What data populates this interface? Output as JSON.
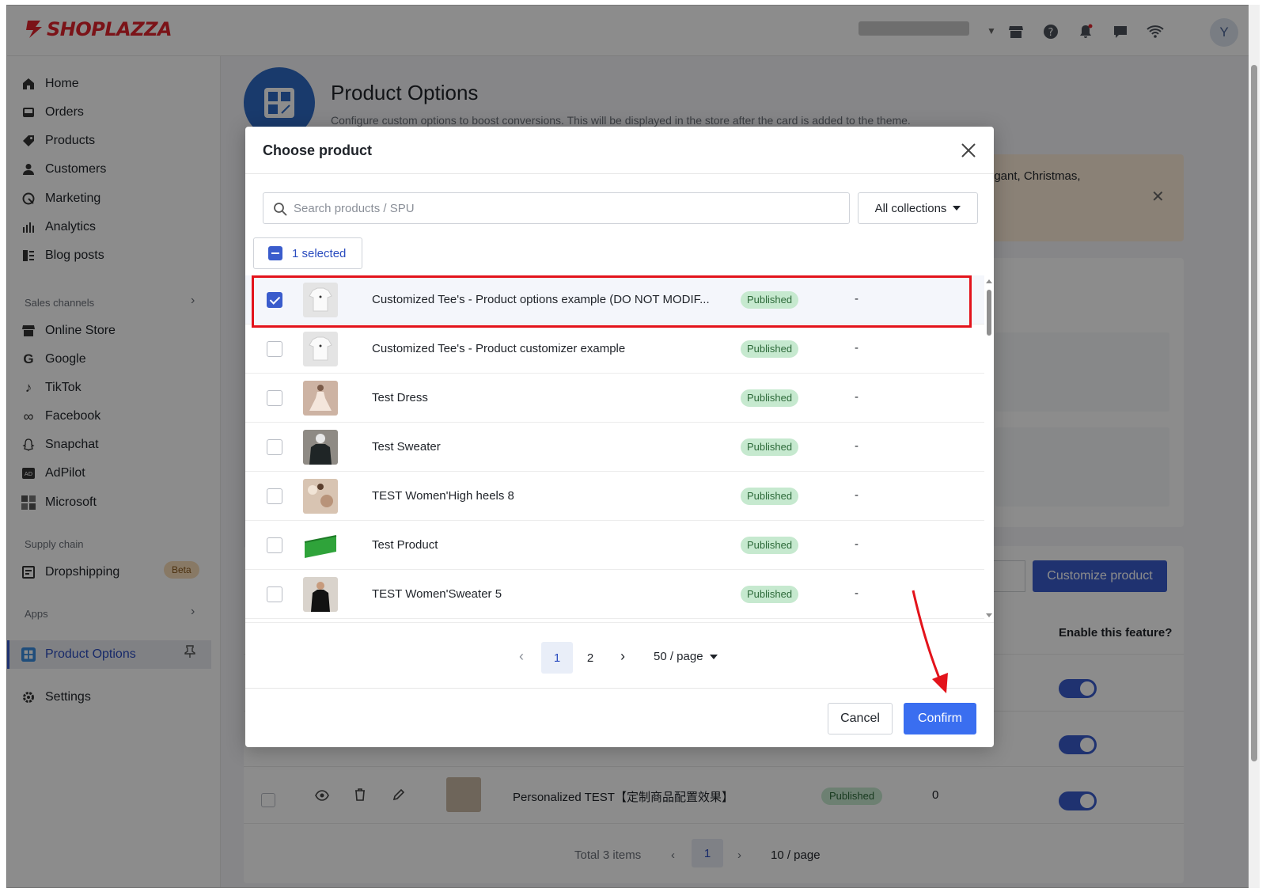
{
  "app": {
    "brand": "SHOPLAZZA",
    "avatar_letter": "Y",
    "accent": "#3a5ccc"
  },
  "sidebar": {
    "main_items": [
      {
        "label": "Home",
        "icon": "home-icon"
      },
      {
        "label": "Orders",
        "icon": "orders-icon"
      },
      {
        "label": "Products",
        "icon": "tag-icon"
      },
      {
        "label": "Customers",
        "icon": "person-icon"
      },
      {
        "label": "Marketing",
        "icon": "marketing-icon"
      },
      {
        "label": "Analytics",
        "icon": "bar-chart-icon"
      },
      {
        "label": "Blog posts",
        "icon": "blog-icon"
      }
    ],
    "sales_channels_label": "Sales channels",
    "sales_channels": [
      {
        "label": "Online Store",
        "icon": "store-icon"
      },
      {
        "label": "Google",
        "icon": "google-icon"
      },
      {
        "label": "TikTok",
        "icon": "tiktok-icon"
      },
      {
        "label": "Facebook",
        "icon": "facebook-icon"
      },
      {
        "label": "Snapchat",
        "icon": "snapchat-icon"
      },
      {
        "label": "AdPilot",
        "icon": "adpilot-icon"
      },
      {
        "label": "Microsoft",
        "icon": "microsoft-icon"
      }
    ],
    "supply_chain_label": "Supply chain",
    "dropshipping_label": "Dropshipping",
    "beta_label": "Beta",
    "apps_label": "Apps",
    "active_app_label": "Product Options",
    "settings_label": "Settings"
  },
  "page": {
    "title": "Product Options",
    "subtitle": "Configure custom options to boost conversions. This will be displayed in the store after the card is added to the theme.",
    "banner_text": "egant, Christmas,",
    "customize_button": "Customize product",
    "enable_label": "Enable this feature?",
    "bg_row": {
      "name": "Personalized TEST【定制商品配置效果】",
      "status": "Published",
      "count": "0"
    },
    "bg_pager": {
      "total": "Total 3 items",
      "current": "1",
      "page_size": "10 / page"
    }
  },
  "modal": {
    "title": "Choose product",
    "search_placeholder": "Search products / SPU",
    "search_value": "",
    "collection_filter": "All collections",
    "selected_label": "1 selected",
    "products": [
      {
        "name": "Customized Tee's - Product options example (DO NOT MODIF...",
        "status": "Published",
        "extra": "-",
        "checked": true,
        "thumb": "white-tshirt"
      },
      {
        "name": "Customized Tee's - Product customizer example",
        "status": "Published",
        "extra": "-",
        "checked": false,
        "thumb": "white-tshirt"
      },
      {
        "name": "Test Dress",
        "status": "Published",
        "extra": "-",
        "checked": false,
        "thumb": "dress"
      },
      {
        "name": "Test Sweater",
        "status": "Published",
        "extra": "-",
        "checked": false,
        "thumb": "sweater"
      },
      {
        "name": "TEST Women'High heels 8",
        "status": "Published",
        "extra": "-",
        "checked": false,
        "thumb": "heels"
      },
      {
        "name": "Test Product",
        "status": "Published",
        "extra": "-",
        "checked": false,
        "thumb": "green-product"
      },
      {
        "name": "TEST Women'Sweater 5",
        "status": "Published",
        "extra": "-",
        "checked": false,
        "thumb": "black-sweater"
      }
    ],
    "pagination": {
      "pages": [
        "1",
        "2"
      ],
      "current": "1",
      "page_size": "50 / page"
    },
    "cancel_label": "Cancel",
    "confirm_label": "Confirm"
  }
}
